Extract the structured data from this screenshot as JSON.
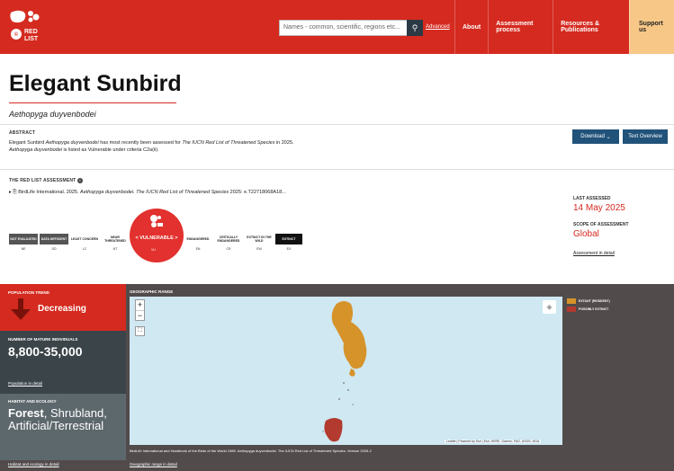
{
  "header": {
    "logo_text": "RED LIST",
    "search_placeholder": "Names - common, scientific, regions etc...",
    "advanced": "Advanced",
    "nav": [
      "About",
      "Assessment process",
      "Resources & Publications",
      "Support us"
    ]
  },
  "species": {
    "common_name": "Elegant Sunbird",
    "scientific_name": "Aethopyga duyvenbodei"
  },
  "abstract": {
    "label": "ABSTRACT",
    "text_1": "Elegant Sunbird ",
    "sci_1": "Aethopyga duyvenbodei",
    "text_2": " has most recently been assessed for ",
    "pub": "The IUCN Red List of Threatened Species",
    "text_3": " in 2025. ",
    "sci_2": "Aethopyga duyvenbodei",
    "text_4": " is listed as Vulnerable under criteria C2a(ii)."
  },
  "buttons": {
    "download": "Download",
    "text_overview": "Text Overview"
  },
  "assessment": {
    "label": "THE RED LIST ASSESSMENT",
    "citation_a": "BirdLife International. 2025. ",
    "citation_b": "Aethopyga duyvenbodei. The IUCN Red List of Threatened Species",
    "citation_c": " 2025: e.T22718068A18...",
    "categories": [
      {
        "name": "NOT EVALUATED",
        "abbr": "NE"
      },
      {
        "name": "DATA DEFICIENT",
        "abbr": "DD"
      },
      {
        "name": "LEAST CONCERN",
        "abbr": "LC"
      },
      {
        "name": "NEAR THREATENED",
        "abbr": "NT"
      },
      {
        "name": "VULNERABLE",
        "abbr": "VU"
      },
      {
        "name": "ENDANGERED",
        "abbr": "EN"
      },
      {
        "name": "CRITICALLY ENDANGERED",
        "abbr": "CR"
      },
      {
        "name": "EXTINCT IN THE WILD",
        "abbr": "EW"
      },
      {
        "name": "EXTINCT",
        "abbr": "EX"
      }
    ],
    "current_label": "< VULNERABLE >",
    "current_abbr": "VU",
    "last_assessed_label": "LAST ASSESSED",
    "last_assessed": "14 May 2025",
    "scope_label": "SCOPE OF ASSESSMENT",
    "scope": "Global",
    "detail_link": "Assessment in detail"
  },
  "population": {
    "trend_label": "POPULATION TREND",
    "trend": "Decreasing",
    "mature_label": "NUMBER OF MATURE INDIVIDUALS",
    "mature": "8,800-35,000",
    "link": "Population in detail"
  },
  "habitat": {
    "label": "HABITAT AND ECOLOGY",
    "primary": "Forest",
    "rest": ", Shrubland, Artificial/Terrestrial",
    "link": "Habitat and ecology in detail"
  },
  "geo": {
    "label": "GEOGRAPHIC RANGE",
    "legend": [
      {
        "label": "EXTANT (RESIDENT)",
        "color": "#d6932a"
      },
      {
        "label": "POSSIBLY EXTINCT",
        "color": "#b23a2e"
      }
    ],
    "attribution": "Leaflet | Powered by Esri | Esri, HERE, Garmin, FAO, USGS, NGA",
    "source": "BirdLife International and Handbook of the Birds of the World 1989. Aethopyga duyvenbodei. The IUCN Red List of Threatened Species. Version 2025-2",
    "link": "Geographic range in detail"
  },
  "colors": {
    "brand_red": "#d52a1f",
    "button_blue": "#21527a",
    "support_orange": "#f7c787"
  }
}
